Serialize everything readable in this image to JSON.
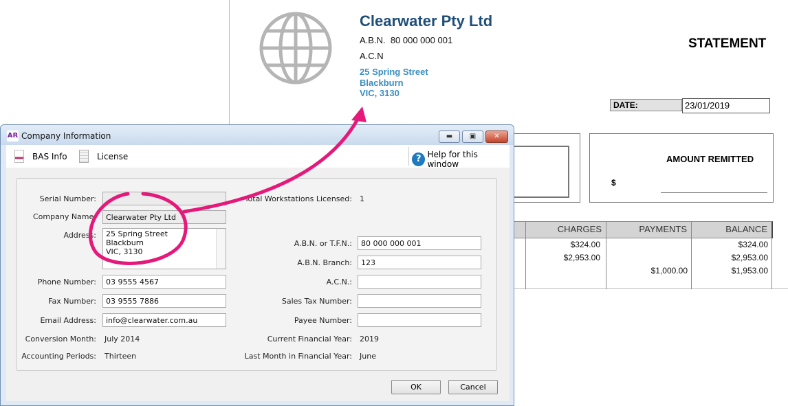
{
  "statement": {
    "company_name": "Clearwater Pty Ltd",
    "abn_label": "A.B.N.",
    "abn": "80 000 000 001",
    "acn_label": "A.C.N",
    "address": [
      "25 Spring Street",
      "Blackburn",
      "VIC, 3130"
    ],
    "title": "STATEMENT",
    "date_label": "DATE:",
    "date": "23/01/2019",
    "amount_remitted": "AMOUNT REMITTED",
    "dollar": "$",
    "columns": [
      "CHARGES",
      "PAYMENTS",
      "BALANCE"
    ],
    "rows": [
      {
        "charges": "$324.00",
        "payments": "",
        "balance": "$324.00"
      },
      {
        "charges": "$2,953.00",
        "payments": "",
        "balance": "$2,953.00"
      },
      {
        "charges": "",
        "payments": "$1,000.00",
        "balance": "$1,953.00"
      }
    ],
    "company_name_color": "#1f4e79",
    "address_color": "#3a8fc0"
  },
  "dialog": {
    "app_badge": "AR",
    "title": "Company Information",
    "toolbar": {
      "bas_info": "BAS Info",
      "license": "License",
      "help": "Help for this window"
    },
    "left": {
      "serial_label": "Serial Number:",
      "serial": "",
      "company_label": "Company Name:",
      "company": "Clearwater Pty Ltd",
      "address_label": "Address:",
      "address": "25 Spring Street\nBlackburn\nVIC, 3130",
      "phone_label": "Phone Number:",
      "phone": "03 9555 4567",
      "fax_label": "Fax Number:",
      "fax": "03 9555 7886",
      "email_label": "Email Address:",
      "email": "info@clearwater.com.au",
      "conversion_label": "Conversion Month:",
      "conversion": "July 2014",
      "periods_label": "Accounting Periods:",
      "periods": "Thirteen"
    },
    "right": {
      "workstations_label": "Total Workstations Licensed:",
      "workstations": "1",
      "abn_label": "A.B.N. or T.F.N.:",
      "abn": "80 000 000 001",
      "branch_label": "A.B.N. Branch:",
      "branch": "123",
      "acn_label": "A.C.N.:",
      "acn": "",
      "salestax_label": "Sales Tax Number:",
      "salestax": "",
      "payee_label": "Payee Number:",
      "payee": "",
      "fy_label": "Current Financial Year:",
      "fy": "2019",
      "lastmonth_label": "Last Month in Financial Year:",
      "lastmonth": "June"
    },
    "ok": "OK",
    "cancel": "Cancel"
  },
  "annotation_color": "#e5197a"
}
